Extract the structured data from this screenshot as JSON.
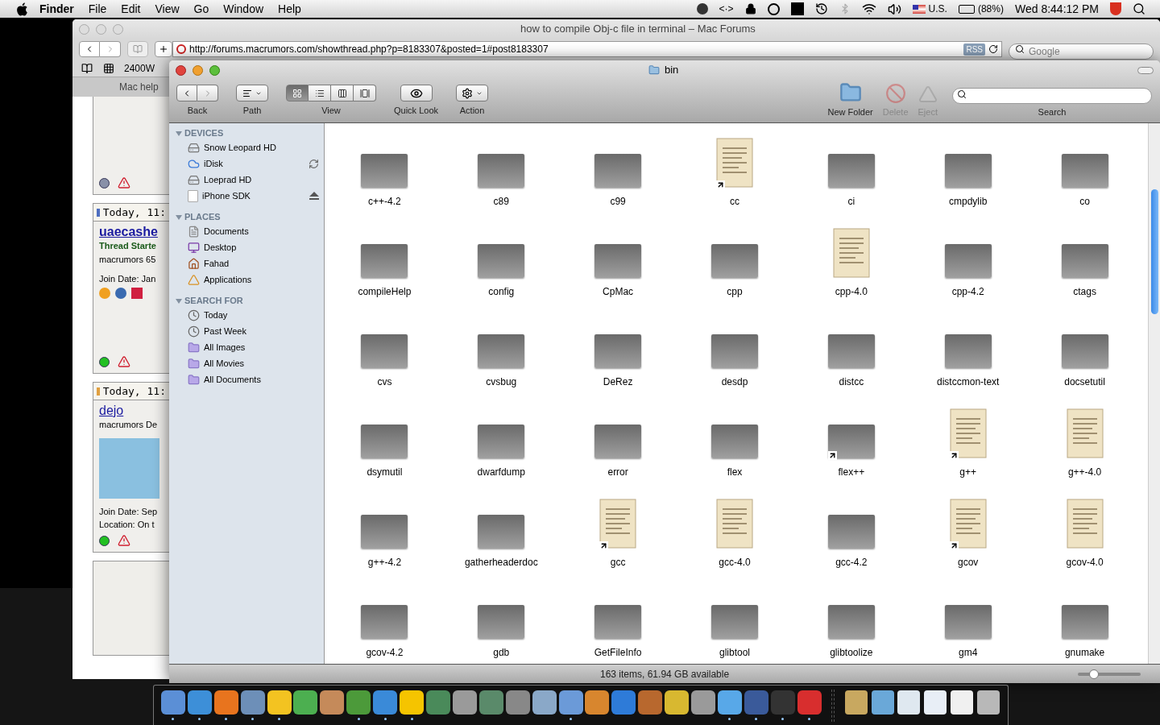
{
  "menu_bar": {
    "app": "Finder",
    "menus": [
      "File",
      "Edit",
      "View",
      "Go",
      "Window",
      "Help"
    ],
    "brackets": "<·>",
    "input_source": "U.S.",
    "battery": "(88%)",
    "clock": "Wed 8:44:12 PM"
  },
  "browser": {
    "title": "how to compile Obj-c file in terminal – Mac Forums",
    "url": "http://forums.macrumors.com/showthread.php?p=8183307&posted=1#post8183307",
    "rss": "RSS",
    "search_placeholder": "Google",
    "bookmark": "2400W",
    "tab": "Mac help",
    "posts": [
      {
        "date": "Today, 11:",
        "user": "uaecashe",
        "bold_user": true,
        "rank": "Thread Starte",
        "title": "macrumors 65",
        "join": "Join Date: Jan",
        "online": true,
        "has_avatar": false,
        "has_im": true,
        "color": "#4f6fc0"
      },
      {
        "date": "Today, 11:",
        "user": "dejo",
        "bold_user": false,
        "title": "macrumors De",
        "join": "Join Date: Sep",
        "location": "Location: On t",
        "online": true,
        "has_avatar": true,
        "has_im": false,
        "color": "#e0a040"
      }
    ]
  },
  "finder": {
    "title": "bin",
    "toolbar": [
      {
        "kind": "nav",
        "label": "Back"
      },
      {
        "kind": "path",
        "label": "Path"
      },
      {
        "kind": "view",
        "label": "View",
        "modes": [
          {
            "selected": true
          },
          {
            "selected": false
          },
          {
            "selected": false
          },
          {
            "selected": false
          }
        ]
      },
      {
        "kind": "quicklook",
        "label": "Quick Look"
      },
      {
        "kind": "action",
        "label": "Action"
      }
    ],
    "toolbar_right": [
      {
        "kind": "newfolder",
        "label": "New Folder",
        "disabled": false
      },
      {
        "kind": "delete",
        "label": "Delete",
        "disabled": true
      },
      {
        "kind": "eject",
        "label": "Eject",
        "disabled": true
      }
    ],
    "search_label": "Search",
    "sidebar": [
      {
        "heading": "DEVICES",
        "expanded": true,
        "items": [
          {
            "label": "Snow Leopard HD",
            "kind": "disk",
            "syncing": false,
            "ejectable": false
          },
          {
            "label": "iDisk",
            "kind": "idisk",
            "syncing": true,
            "ejectable": false
          },
          {
            "label": "Loeprad HD",
            "kind": "disk",
            "syncing": false,
            "ejectable": false
          },
          {
            "label": "iPhone SDK",
            "kind": "volume",
            "syncing": false,
            "ejectable": true
          }
        ]
      },
      {
        "heading": "PLACES",
        "expanded": true,
        "items": [
          {
            "label": "Documents",
            "kind": "documents"
          },
          {
            "label": "Desktop",
            "kind": "desktop"
          },
          {
            "label": "Fahad",
            "kind": "home"
          },
          {
            "label": "Applications",
            "kind": "apps"
          }
        ]
      },
      {
        "heading": "SEARCH FOR",
        "expanded": true,
        "items": [
          {
            "label": "Today",
            "kind": "clock"
          },
          {
            "label": "Past Week",
            "kind": "clock"
          },
          {
            "label": "All Images",
            "kind": "smart"
          },
          {
            "label": "All Movies",
            "kind": "smart"
          },
          {
            "label": "All Documents",
            "kind": "smart"
          }
        ]
      }
    ],
    "files": [
      {
        "name": "c++-4.2",
        "kind": "exec",
        "alias": false
      },
      {
        "name": "c89",
        "kind": "exec",
        "alias": false
      },
      {
        "name": "c99",
        "kind": "exec",
        "alias": false
      },
      {
        "name": "cc",
        "kind": "doc",
        "alias": true
      },
      {
        "name": "ci",
        "kind": "exec",
        "alias": false
      },
      {
        "name": "cmpdylib",
        "kind": "exec",
        "alias": false
      },
      {
        "name": "co",
        "kind": "exec",
        "alias": false
      },
      {
        "name": "compileHelp",
        "kind": "exec",
        "alias": false
      },
      {
        "name": "config",
        "kind": "exec",
        "alias": false
      },
      {
        "name": "CpMac",
        "kind": "exec",
        "alias": false
      },
      {
        "name": "cpp",
        "kind": "exec",
        "alias": false
      },
      {
        "name": "cpp-4.0",
        "kind": "doc",
        "alias": false
      },
      {
        "name": "cpp-4.2",
        "kind": "exec",
        "alias": false
      },
      {
        "name": "ctags",
        "kind": "exec",
        "alias": false
      },
      {
        "name": "cvs",
        "kind": "exec",
        "alias": false
      },
      {
        "name": "cvsbug",
        "kind": "exec",
        "alias": false
      },
      {
        "name": "DeRez",
        "kind": "exec",
        "alias": false
      },
      {
        "name": "desdp",
        "kind": "exec",
        "alias": false
      },
      {
        "name": "distcc",
        "kind": "exec",
        "alias": false
      },
      {
        "name": "distccmon-text",
        "kind": "exec",
        "alias": false
      },
      {
        "name": "docsetutil",
        "kind": "exec",
        "alias": false
      },
      {
        "name": "dsymutil",
        "kind": "exec",
        "alias": false
      },
      {
        "name": "dwarfdump",
        "kind": "exec",
        "alias": false
      },
      {
        "name": "error",
        "kind": "exec",
        "alias": false
      },
      {
        "name": "flex",
        "kind": "exec",
        "alias": false
      },
      {
        "name": "flex++",
        "kind": "exec",
        "alias": true
      },
      {
        "name": "g++",
        "kind": "doc",
        "alias": true
      },
      {
        "name": "g++-4.0",
        "kind": "doc",
        "alias": false
      },
      {
        "name": "g++-4.2",
        "kind": "exec",
        "alias": false
      },
      {
        "name": "gatherheaderdoc",
        "kind": "exec",
        "alias": false
      },
      {
        "name": "gcc",
        "kind": "doc",
        "alias": true
      },
      {
        "name": "gcc-4.0",
        "kind": "doc",
        "alias": false
      },
      {
        "name": "gcc-4.2",
        "kind": "exec",
        "alias": false
      },
      {
        "name": "gcov",
        "kind": "doc",
        "alias": true
      },
      {
        "name": "gcov-4.0",
        "kind": "doc",
        "alias": false
      },
      {
        "name": "gcov-4.2",
        "kind": "exec",
        "alias": false
      },
      {
        "name": "gdb",
        "kind": "exec",
        "alias": false
      },
      {
        "name": "GetFileInfo",
        "kind": "exec",
        "alias": false
      },
      {
        "name": "glibtool",
        "kind": "exec",
        "alias": false
      },
      {
        "name": "glibtoolize",
        "kind": "exec",
        "alias": false
      },
      {
        "name": "gm4",
        "kind": "exec",
        "alias": false
      },
      {
        "name": "gnumake",
        "kind": "exec",
        "alias": false
      }
    ],
    "status": "163 items, 61.94 GB available",
    "icon_size": {
      "level": 0.25
    }
  },
  "dock": {
    "apps": [
      {
        "running": true
      },
      {
        "running": true
      },
      {
        "running": true
      },
      {
        "running": true
      },
      {
        "running": true
      },
      {
        "running": false
      },
      {
        "running": false
      },
      {
        "running": true
      },
      {
        "running": true
      },
      {
        "running": true
      },
      {
        "running": false
      },
      {
        "running": false
      },
      {
        "running": false
      },
      {
        "running": false
      },
      {
        "running": false
      },
      {
        "running": true
      },
      {
        "running": false
      },
      {
        "running": false
      },
      {
        "running": false
      },
      {
        "running": false
      },
      {
        "running": false
      },
      {
        "running": true
      },
      {
        "running": true
      },
      {
        "running": true
      },
      {
        "running": true
      }
    ],
    "stacks": [
      {
        "running": false
      },
      {
        "running": false
      },
      {
        "running": false
      },
      {
        "running": false
      },
      {
        "running": false
      },
      {
        "running": false
      }
    ]
  }
}
